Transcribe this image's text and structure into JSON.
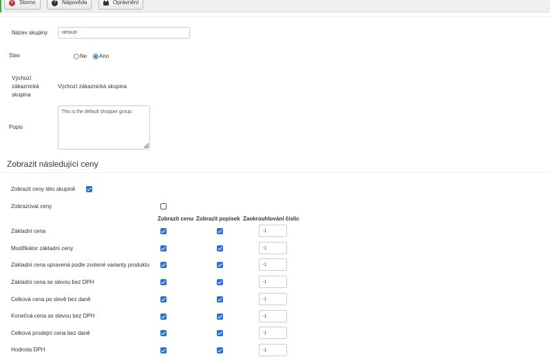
{
  "toolbar": {
    "cancel_label": "Storno",
    "help_label": "Nápověda",
    "permissions_label": "Oprávnění"
  },
  "form": {
    "group_name_label": "Název skupiny",
    "group_name_value": "-default-",
    "status_label": "Stav",
    "status_options": [
      "Ne",
      "Ano"
    ],
    "status_selected": "Ano",
    "default_group_label_line1": "Výchozí",
    "default_group_label_line2": "zákaznická",
    "default_group_label_line3": "skupina",
    "default_group_value": "Výchozí zákaznická skupina",
    "description_label": "Popis",
    "description_value": "This is the default shopper group."
  },
  "prices_section": {
    "title": "Zobrazit následující ceny",
    "show_group_prices_label": "Zobrazit ceny této skupině",
    "show_group_prices_checked": true,
    "show_prices_label": "Zobrazovat ceny",
    "show_prices_checked": false,
    "column_headers": [
      "Zobrazit cenu",
      "Zobrazit popisek",
      "Zaokrouhlování čislic"
    ],
    "rows": [
      {
        "label": "Základní cena",
        "show_price": true,
        "show_label": true,
        "rounding": "-1"
      },
      {
        "label": "Modifikátor základní ceny",
        "show_price": true,
        "show_label": true,
        "rounding": "-1"
      },
      {
        "label": "Základní cena upravená podle zvolené varianty produktu",
        "show_price": true,
        "show_label": true,
        "rounding": "-1"
      },
      {
        "label": "Základní cena se slevou bez DPH",
        "show_price": true,
        "show_label": true,
        "rounding": "-1"
      },
      {
        "label": "Celková cena po slevě bez daně",
        "show_price": true,
        "show_label": true,
        "rounding": "-1"
      },
      {
        "label": "Konečná cena se slevou bez DPH",
        "show_price": true,
        "show_label": true,
        "rounding": "-1"
      },
      {
        "label": "Celková prodejní cena bez daně",
        "show_price": true,
        "show_label": true,
        "rounding": "-1"
      },
      {
        "label": "Hodnota DPH",
        "show_price": true,
        "show_label": true,
        "rounding": "-1"
      }
    ]
  },
  "colors": {
    "accent": "#2a6fd6",
    "toolbar_bg": "#f0f0f0",
    "cancel_icon": "#bd362f"
  }
}
